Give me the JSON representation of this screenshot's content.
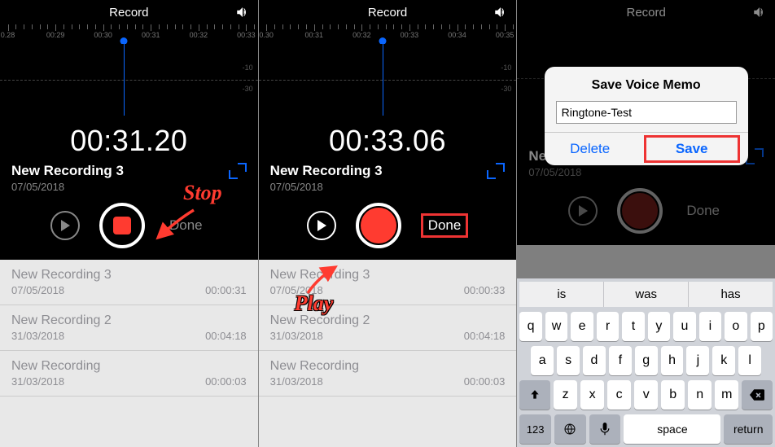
{
  "pane1": {
    "title": "Record",
    "ruler": [
      "0.28",
      "00:29",
      "00:30",
      "00:31",
      "00:32",
      "00:33"
    ],
    "playhead_pct": 48,
    "timer": "00:31.20",
    "recording_name": "New Recording 3",
    "recording_date": "07/05/2018",
    "done_label": "Done",
    "annotation_stop": "Stop",
    "list": [
      {
        "name": "New Recording 3",
        "date": "07/05/2018",
        "dur": "00:00:31"
      },
      {
        "name": "New Recording 2",
        "date": "31/03/2018",
        "dur": "00:04:18"
      },
      {
        "name": "New Recording",
        "date": "31/03/2018",
        "dur": "00:00:03"
      }
    ]
  },
  "pane2": {
    "title": "Record",
    "ruler": [
      "0.30",
      "00:31",
      "00:32",
      "00:33",
      "00:34",
      "00:35"
    ],
    "playhead_pct": 48,
    "timer": "00:33.06",
    "recording_name": "New Recording 3",
    "recording_date": "07/05/2018",
    "done_label": "Done",
    "annotation_play": "Play",
    "list": [
      {
        "name": "New Recording 3",
        "date": "07/05/2018",
        "dur": "00:00:33"
      },
      {
        "name": "New Recording 2",
        "date": "31/03/2018",
        "dur": "00:04:18"
      },
      {
        "name": "New Recording",
        "date": "31/03/2018",
        "dur": "00:00:03"
      }
    ]
  },
  "pane3": {
    "title": "Record",
    "recording_name": "New Recording 3",
    "recording_date": "07/05/2018",
    "done_label": "Done",
    "dialog_title": "Save Voice Memo",
    "dialog_value": "Ringtone-Test",
    "dialog_delete": "Delete",
    "dialog_save": "Save",
    "suggestions": [
      "is",
      "was",
      "has"
    ],
    "key_rows": [
      [
        "q",
        "w",
        "e",
        "r",
        "t",
        "y",
        "u",
        "i",
        "o",
        "p"
      ],
      [
        "a",
        "s",
        "d",
        "f",
        "g",
        "h",
        "j",
        "k",
        "l"
      ],
      [
        "z",
        "x",
        "c",
        "v",
        "b",
        "n",
        "m"
      ]
    ],
    "key_123": "123",
    "key_space": "space",
    "key_return": "return"
  }
}
